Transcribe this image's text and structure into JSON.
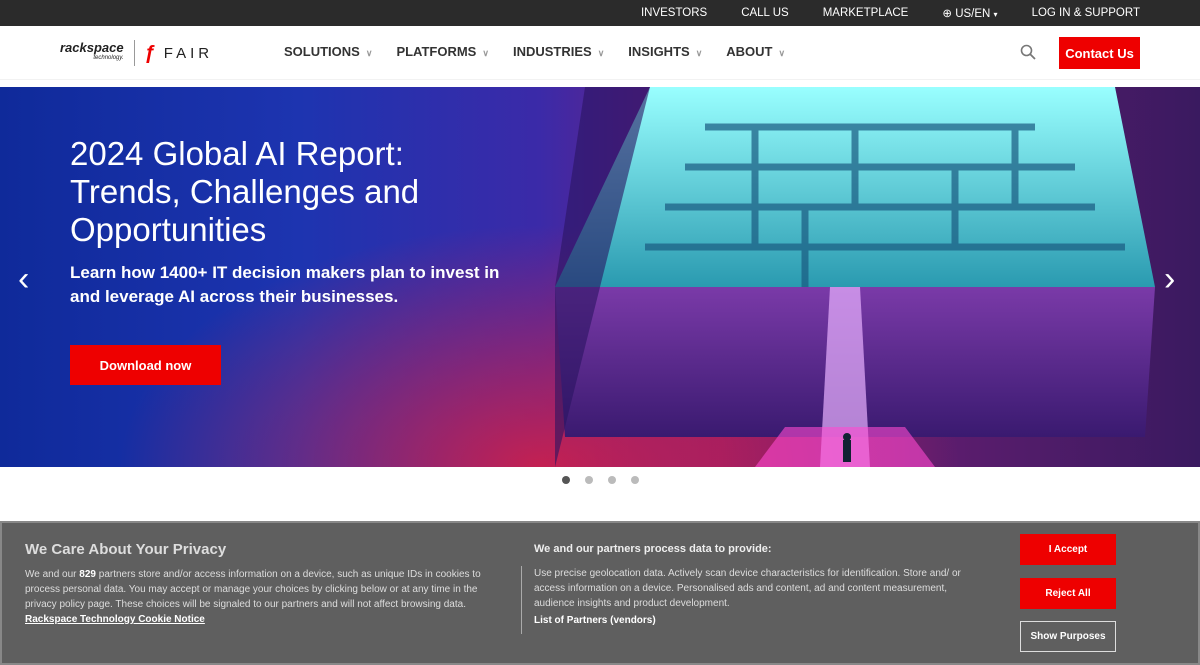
{
  "topbar": {
    "items": [
      "INVESTORS",
      "CALL US",
      "MARKETPLACE",
      "US/EN",
      "LOG IN & SUPPORT"
    ]
  },
  "logo": {
    "rackspace": "rackspace",
    "technology": "technology.",
    "fair": "FAIR"
  },
  "nav": {
    "items": [
      "SOLUTIONS",
      "PLATFORMS",
      "INDUSTRIES",
      "INSIGHTS",
      "ABOUT"
    ],
    "contact": "Contact Us"
  },
  "hero": {
    "title": "2024 Global AI Report: Trends, Challenges and Opportunities",
    "subtitle": "Learn how 1400+ IT decision makers plan to invest in and leverage AI across their businesses.",
    "cta": "Download now",
    "slide_count": 4,
    "active_slide": 1
  },
  "cookie": {
    "title": "We Care About Your Privacy",
    "text_before": "We and our ",
    "partners_count": "829",
    "text_after": " partners store and/or access information on a device, such as unique IDs in cookies to process personal data. You may accept or manage your choices by clicking below or at any time in the privacy policy page. These choices will be signaled to our partners and will not affect browsing data. ",
    "notice_link": "Rackspace Technology Cookie Notice",
    "purposes_title": "We and our partners process data to provide:",
    "purposes_text": "Use precise geolocation data. Actively scan device characteristics for identification. Store and/ or access information on a device. Personalised ads and content, ad and content measurement, audience insights and product development.",
    "partners_link": "List of Partners (vendors)",
    "accept": "I Accept",
    "reject": "Reject All",
    "show_purposes": "Show Purposes"
  },
  "colors": {
    "brand_red": "#e00000",
    "topbar": "#2b2b2b",
    "banner": "#5f5f5f"
  }
}
